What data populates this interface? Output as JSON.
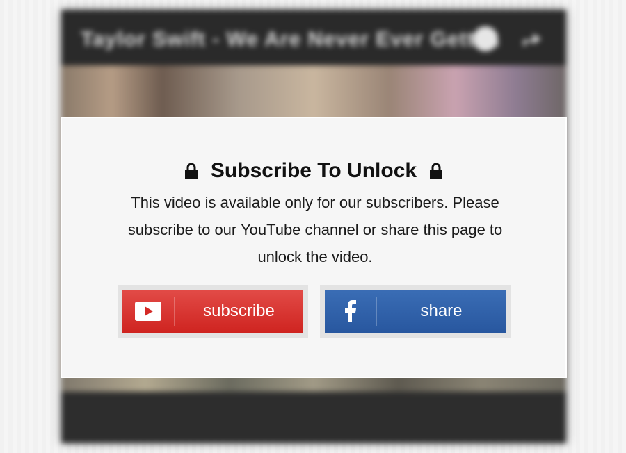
{
  "player": {
    "title": "Taylor Swift - We Are Never Ever Getti..."
  },
  "overlay": {
    "title": "Subscribe To Unlock",
    "message": "This video is available only for our subscribers. Please subscribe to our YouTube channel or share this page to unlock the video.",
    "subscribe_button": {
      "label": "subscribe",
      "icon": "youtube-icon",
      "color": "#d9332f"
    },
    "share_button": {
      "label": "share",
      "icon": "facebook-icon",
      "color": "#3163ac"
    },
    "lock_icon": "lock-icon"
  }
}
